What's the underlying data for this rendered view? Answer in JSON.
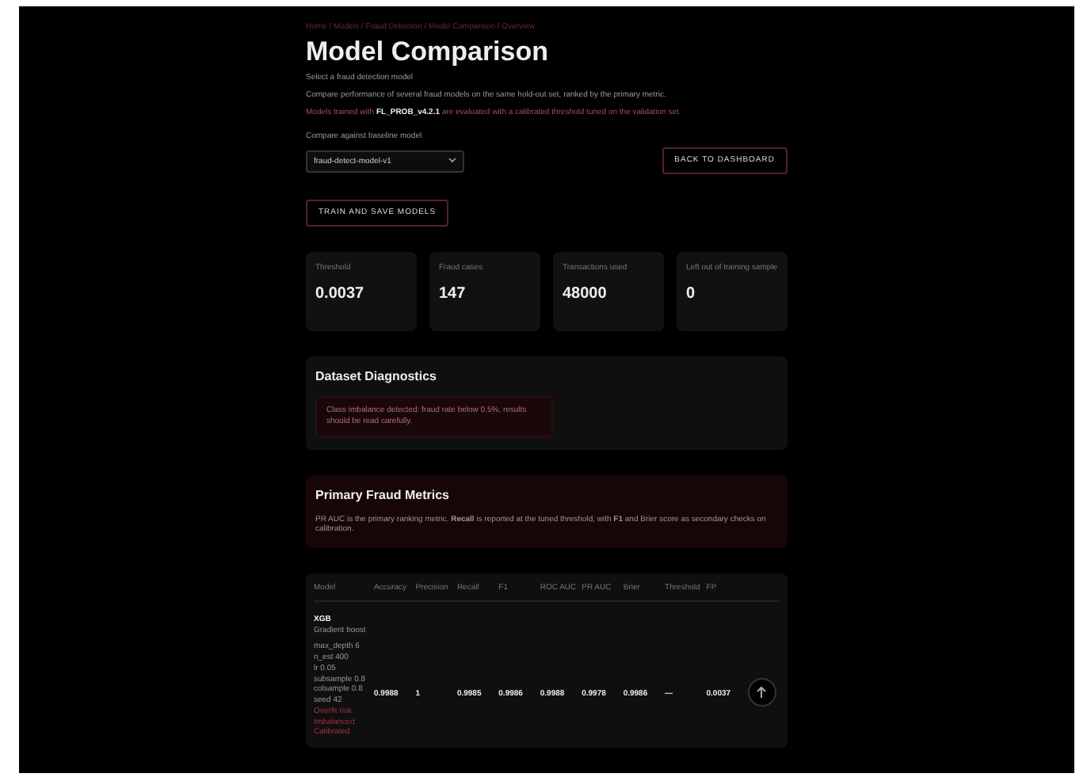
{
  "breadcrumb": "Home / Models / Fraud Detection / Model Comparison / Overview",
  "title": "Model Comparison",
  "subtitle": "Select a fraud detection model",
  "intro": "Compare performance of several fraud models on the same hold-out set, ranked by the primary metric.",
  "note": "Models trained with **FL_PROB_v4.2.1** are evaluated with a calibrated threshold tuned on the validation set.",
  "select_label": "Compare against baseline model",
  "select": {
    "value": "fraud-detect-model-v1"
  },
  "back_button": "BACK TO DASHBOARD",
  "train_button": "TRAIN AND SAVE MODELS",
  "stats": [
    {
      "label": "Threshold",
      "value": "0.0037"
    },
    {
      "label": "Fraud cases",
      "value": "147"
    },
    {
      "label": "Transactions used",
      "value": "48000"
    },
    {
      "label": "Left out of training sample",
      "value": "0"
    }
  ],
  "diagnostics": {
    "title": "Dataset Diagnostics",
    "alert": "Class imbalance detected: fraud rate below 0.5%, results should be read carefully."
  },
  "metrics": {
    "title": "Primary Fraud Metrics",
    "text": "PR AUC is the primary ranking metric. **Recall** is reported at the tuned threshold, with **F1** and Brier score as secondary checks on calibration."
  },
  "table": {
    "columns": [
      "Model",
      "Accuracy",
      "Precision",
      "Recall",
      "F1",
      "ROC AUC",
      "PR AUC",
      "Brier",
      "Threshold",
      "FP"
    ],
    "rows": [
      {
        "type": "Gradient boost",
        "details": [
          "max_depth 6",
          "n_est 400",
          "lr 0.05",
          "subsample 0.8",
          "colsample 0.8",
          "seed 42"
        ],
        "flags": [
          "Overfit risk",
          "Imbalanced",
          "Calibrated"
        ],
        "cells": [
          "XGB",
          "0.9988",
          "1",
          "0.9985",
          "0.9986",
          "0.9988",
          "0.9978",
          "0.9986",
          "—",
          "0.0037"
        ]
      }
    ]
  }
}
